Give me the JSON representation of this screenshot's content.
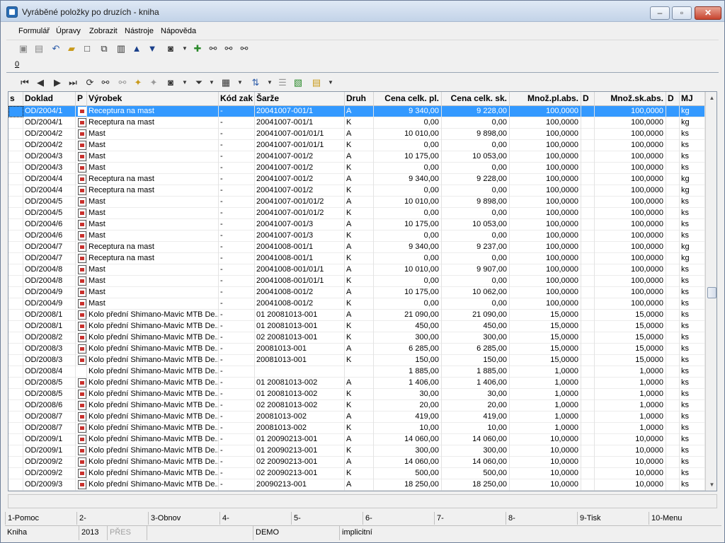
{
  "window": {
    "title": "Vyráběné položky po druzích - kniha"
  },
  "menu": [
    "Formulář",
    "Úpravy",
    "Zobrazit",
    "Nástroje",
    "Nápověda"
  ],
  "toolbar1": [
    "save-icon",
    "save-all-icon",
    "undo-icon",
    "open-folder-icon",
    "new-doc-icon",
    "copy-doc-icon",
    "book-icon",
    "arrow-up-icon",
    "arrow-down-icon",
    "camera-icon",
    "dropdown-icon",
    "refresh-icon",
    "binoculars-icon",
    "binoculars-next-icon",
    "binoculars-prev-icon"
  ],
  "tab": {
    "label": "0"
  },
  "toolbar2": [
    "first-icon",
    "prev-icon",
    "next-icon",
    "last-icon",
    "reload-icon",
    "find-icon",
    "find-next-icon",
    "star-add-icon",
    "star-remove-icon",
    "camera-icon",
    "dropdown-icon",
    "filter-icon",
    "dropdown-icon",
    "columns-icon",
    "dropdown-icon",
    "sort-icon",
    "dropdown-icon",
    "list-icon",
    "export-icon",
    "spreadsheet-icon",
    "dropdown-icon"
  ],
  "grid": {
    "headers": [
      "s",
      "Doklad",
      "P",
      "Výrobek",
      "Kód zak",
      "Šarže",
      "Druh",
      "Cena celk. pl.",
      "Cena celk. sk.",
      "Množ.pl.abs.",
      "D",
      "Množ.sk.abs.",
      "D",
      "MJ"
    ],
    "rows": [
      [
        "",
        "OD/2004/1",
        "y",
        "Receptura na mast",
        "-",
        "20041007-001/1",
        "A",
        "9 340,00",
        "9 228,00",
        "100,0000",
        "",
        "100,0000",
        "",
        "kg"
      ],
      [
        "",
        "OD/2004/1",
        "y",
        "Receptura na mast",
        "-",
        "20041007-001/1",
        "K",
        "0,00",
        "0,00",
        "100,0000",
        "",
        "100,0000",
        "",
        "kg"
      ],
      [
        "",
        "OD/2004/2",
        "y",
        "Mast",
        "-",
        "20041007-001/01/1",
        "A",
        "10 010,00",
        "9 898,00",
        "100,0000",
        "",
        "100,0000",
        "",
        "ks"
      ],
      [
        "",
        "OD/2004/2",
        "y",
        "Mast",
        "-",
        "20041007-001/01/1",
        "K",
        "0,00",
        "0,00",
        "100,0000",
        "",
        "100,0000",
        "",
        "ks"
      ],
      [
        "",
        "OD/2004/3",
        "y",
        "Mast",
        "-",
        "20041007-001/2",
        "A",
        "10 175,00",
        "10 053,00",
        "100,0000",
        "",
        "100,0000",
        "",
        "ks"
      ],
      [
        "",
        "OD/2004/3",
        "y",
        "Mast",
        "-",
        "20041007-001/2",
        "K",
        "0,00",
        "0,00",
        "100,0000",
        "",
        "100,0000",
        "",
        "ks"
      ],
      [
        "",
        "OD/2004/4",
        "y",
        "Receptura na mast",
        "-",
        "20041007-001/2",
        "A",
        "9 340,00",
        "9 228,00",
        "100,0000",
        "",
        "100,0000",
        "",
        "kg"
      ],
      [
        "",
        "OD/2004/4",
        "y",
        "Receptura na mast",
        "-",
        "20041007-001/2",
        "K",
        "0,00",
        "0,00",
        "100,0000",
        "",
        "100,0000",
        "",
        "kg"
      ],
      [
        "",
        "OD/2004/5",
        "y",
        "Mast",
        "-",
        "20041007-001/01/2",
        "A",
        "10 010,00",
        "9 898,00",
        "100,0000",
        "",
        "100,0000",
        "",
        "ks"
      ],
      [
        "",
        "OD/2004/5",
        "y",
        "Mast",
        "-",
        "20041007-001/01/2",
        "K",
        "0,00",
        "0,00",
        "100,0000",
        "",
        "100,0000",
        "",
        "ks"
      ],
      [
        "",
        "OD/2004/6",
        "y",
        "Mast",
        "-",
        "20041007-001/3",
        "A",
        "10 175,00",
        "10 053,00",
        "100,0000",
        "",
        "100,0000",
        "",
        "ks"
      ],
      [
        "",
        "OD/2004/6",
        "y",
        "Mast",
        "-",
        "20041007-001/3",
        "K",
        "0,00",
        "0,00",
        "100,0000",
        "",
        "100,0000",
        "",
        "ks"
      ],
      [
        "",
        "OD/2004/7",
        "y",
        "Receptura na mast",
        "-",
        "20041008-001/1",
        "A",
        "9 340,00",
        "9 237,00",
        "100,0000",
        "",
        "100,0000",
        "",
        "kg"
      ],
      [
        "",
        "OD/2004/7",
        "y",
        "Receptura na mast",
        "-",
        "20041008-001/1",
        "K",
        "0,00",
        "0,00",
        "100,0000",
        "",
        "100,0000",
        "",
        "kg"
      ],
      [
        "",
        "OD/2004/8",
        "y",
        "Mast",
        "-",
        "20041008-001/01/1",
        "A",
        "10 010,00",
        "9 907,00",
        "100,0000",
        "",
        "100,0000",
        "",
        "ks"
      ],
      [
        "",
        "OD/2004/8",
        "y",
        "Mast",
        "-",
        "20041008-001/01/1",
        "K",
        "0,00",
        "0,00",
        "100,0000",
        "",
        "100,0000",
        "",
        "ks"
      ],
      [
        "",
        "OD/2004/9",
        "y",
        "Mast",
        "-",
        "20041008-001/2",
        "A",
        "10 175,00",
        "10 062,00",
        "100,0000",
        "",
        "100,0000",
        "",
        "ks"
      ],
      [
        "",
        "OD/2004/9",
        "y",
        "Mast",
        "-",
        "20041008-001/2",
        "K",
        "0,00",
        "0,00",
        "100,0000",
        "",
        "100,0000",
        "",
        "ks"
      ],
      [
        "",
        "OD/2008/1",
        "y",
        "Kolo přední Shimano-Mavic MTB De...",
        "-",
        "01 20081013-001",
        "A",
        "21 090,00",
        "21 090,00",
        "15,0000",
        "",
        "15,0000",
        "",
        "ks"
      ],
      [
        "",
        "OD/2008/1",
        "y",
        "Kolo přední Shimano-Mavic MTB De...",
        "-",
        "01 20081013-001",
        "K",
        "450,00",
        "450,00",
        "15,0000",
        "",
        "15,0000",
        "",
        "ks"
      ],
      [
        "",
        "OD/2008/2",
        "y",
        "Kolo přední Shimano-Mavic MTB De...",
        "-",
        "02 20081013-001",
        "K",
        "300,00",
        "300,00",
        "15,0000",
        "",
        "15,0000",
        "",
        "ks"
      ],
      [
        "",
        "OD/2008/3",
        "y",
        "Kolo přední Shimano-Mavic MTB De...",
        "-",
        "20081013-001",
        "A",
        "6 285,00",
        "6 285,00",
        "15,0000",
        "",
        "15,0000",
        "",
        "ks"
      ],
      [
        "",
        "OD/2008/3",
        "y",
        "Kolo přední Shimano-Mavic MTB De...",
        "-",
        "20081013-001",
        "K",
        "150,00",
        "150,00",
        "15,0000",
        "",
        "15,0000",
        "",
        "ks"
      ],
      [
        "",
        "OD/2008/4",
        "",
        "Kolo přední Shimano-Mavic MTB De...",
        "-",
        "",
        "",
        "1 885,00",
        "1 885,00",
        "1,0000",
        "",
        "1,0000",
        "",
        "ks"
      ],
      [
        "",
        "OD/2008/5",
        "y",
        "Kolo přední Shimano-Mavic MTB De...",
        "-",
        "01 20081013-002",
        "A",
        "1 406,00",
        "1 406,00",
        "1,0000",
        "",
        "1,0000",
        "",
        "ks"
      ],
      [
        "",
        "OD/2008/5",
        "y",
        "Kolo přední Shimano-Mavic MTB De...",
        "-",
        "01 20081013-002",
        "K",
        "30,00",
        "30,00",
        "1,0000",
        "",
        "1,0000",
        "",
        "ks"
      ],
      [
        "",
        "OD/2008/6",
        "y",
        "Kolo přední Shimano-Mavic MTB De...",
        "-",
        "02 20081013-002",
        "K",
        "20,00",
        "20,00",
        "1,0000",
        "",
        "1,0000",
        "",
        "ks"
      ],
      [
        "",
        "OD/2008/7",
        "y",
        "Kolo přední Shimano-Mavic MTB De...",
        "-",
        "20081013-002",
        "A",
        "419,00",
        "419,00",
        "1,0000",
        "",
        "1,0000",
        "",
        "ks"
      ],
      [
        "",
        "OD/2008/7",
        "y",
        "Kolo přední Shimano-Mavic MTB De...",
        "-",
        "20081013-002",
        "K",
        "10,00",
        "10,00",
        "1,0000",
        "",
        "1,0000",
        "",
        "ks"
      ],
      [
        "",
        "OD/2009/1",
        "y",
        "Kolo přední Shimano-Mavic MTB De...",
        "-",
        "01 20090213-001",
        "A",
        "14 060,00",
        "14 060,00",
        "10,0000",
        "",
        "10,0000",
        "",
        "ks"
      ],
      [
        "",
        "OD/2009/1",
        "y",
        "Kolo přední Shimano-Mavic MTB De...",
        "-",
        "01 20090213-001",
        "K",
        "300,00",
        "300,00",
        "10,0000",
        "",
        "10,0000",
        "",
        "ks"
      ],
      [
        "",
        "OD/2009/2",
        "y",
        "Kolo přední Shimano-Mavic MTB De...",
        "-",
        "02 20090213-001",
        "A",
        "14 060,00",
        "14 060,00",
        "10,0000",
        "",
        "10,0000",
        "",
        "ks"
      ],
      [
        "",
        "OD/2009/2",
        "y",
        "Kolo přední Shimano-Mavic MTB De...",
        "-",
        "02 20090213-001",
        "K",
        "500,00",
        "500,00",
        "10,0000",
        "",
        "10,0000",
        "",
        "ks"
      ],
      [
        "",
        "OD/2009/3",
        "y",
        "Kolo přední Shimano-Mavic MTB De...",
        "-",
        "20090213-001",
        "A",
        "18 250,00",
        "18 250,00",
        "10,0000",
        "",
        "10,0000",
        "",
        "ks"
      ]
    ]
  },
  "fkeys": [
    "1-Pomoc",
    "2-",
    "3-Obnov",
    "4-",
    "5-",
    "6-",
    "7-",
    "8-",
    "9-Tisk",
    "10-Menu"
  ],
  "status": [
    "Kniha",
    "2013",
    "PŘES",
    "",
    "DEMO",
    "implicitní"
  ],
  "colors": {
    "selection": "#3399ff",
    "title_gradient_top": "#dfe9f5"
  }
}
